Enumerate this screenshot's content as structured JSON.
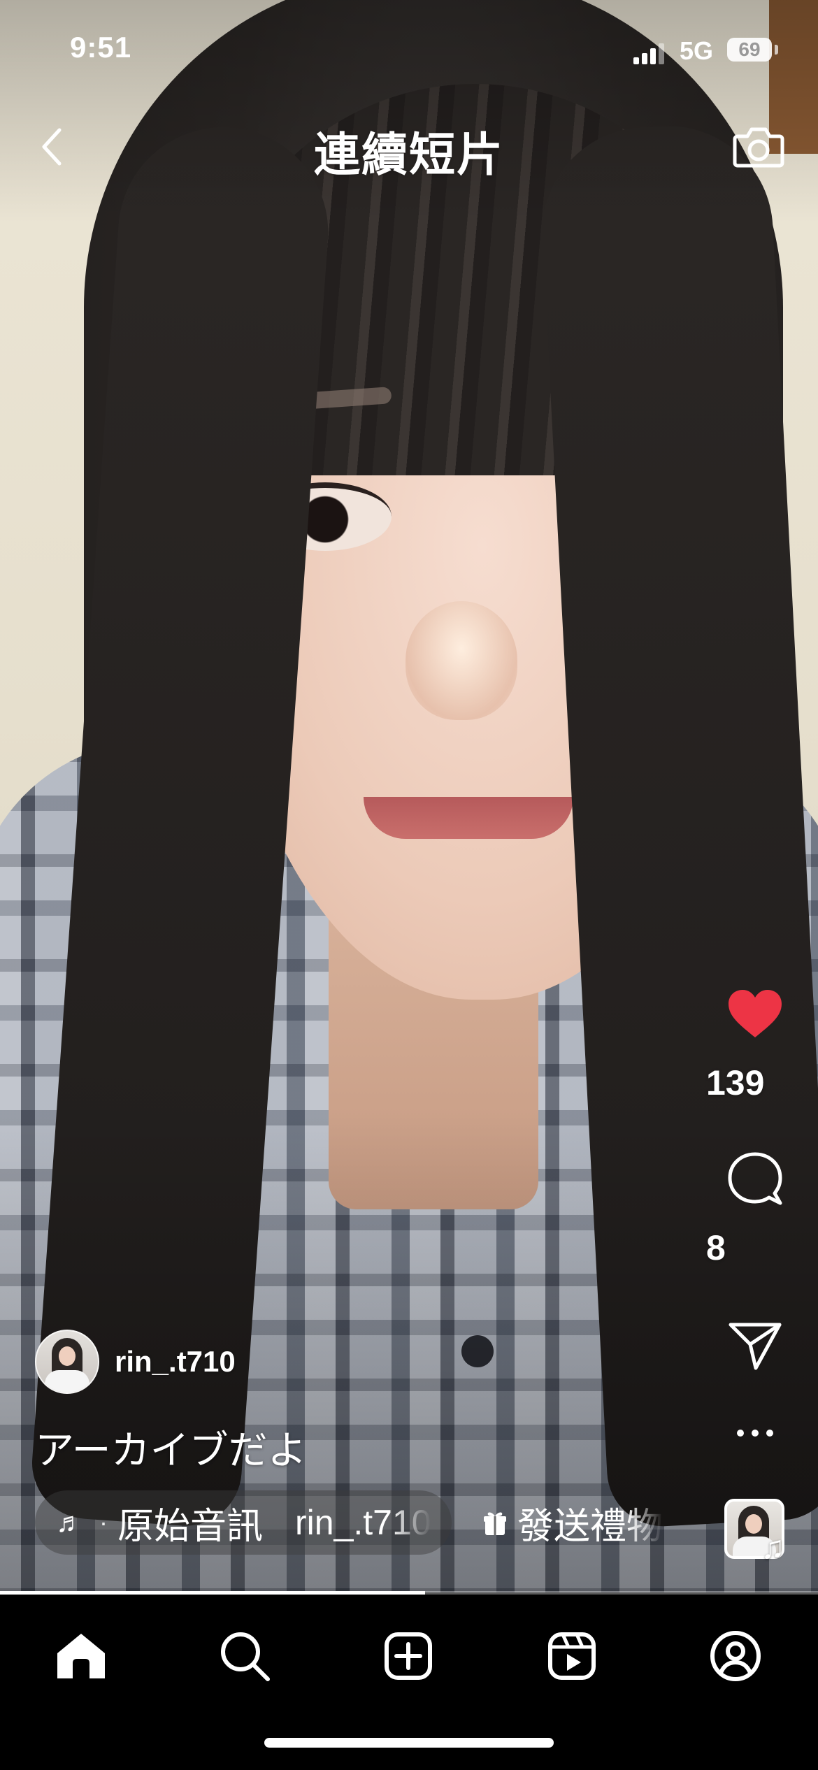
{
  "status_bar": {
    "time": "9:51",
    "network": "5G",
    "battery": "69"
  },
  "header": {
    "title": "連續短片",
    "back_icon": "chevron-left-icon",
    "camera_icon": "camera-icon"
  },
  "actions": {
    "like_count": "139",
    "like_color": "#ed3445",
    "comment_count": "8",
    "share_icon": "send-icon",
    "more_icon": "more-horizontal-icon",
    "audio_icon": "music-note-icon"
  },
  "post": {
    "username": "rin_.t710",
    "caption": "アーカイブだよ"
  },
  "audio": {
    "separator": "·",
    "title": "原始音訊",
    "artist": "rin_.t710"
  },
  "gift": {
    "label": "發送禮物"
  },
  "playback": {
    "progress_percent": 52
  },
  "tab_bar": {
    "items": [
      "home-icon",
      "search-icon",
      "create-icon",
      "reels-icon",
      "profile-icon"
    ],
    "active": "home-icon"
  }
}
